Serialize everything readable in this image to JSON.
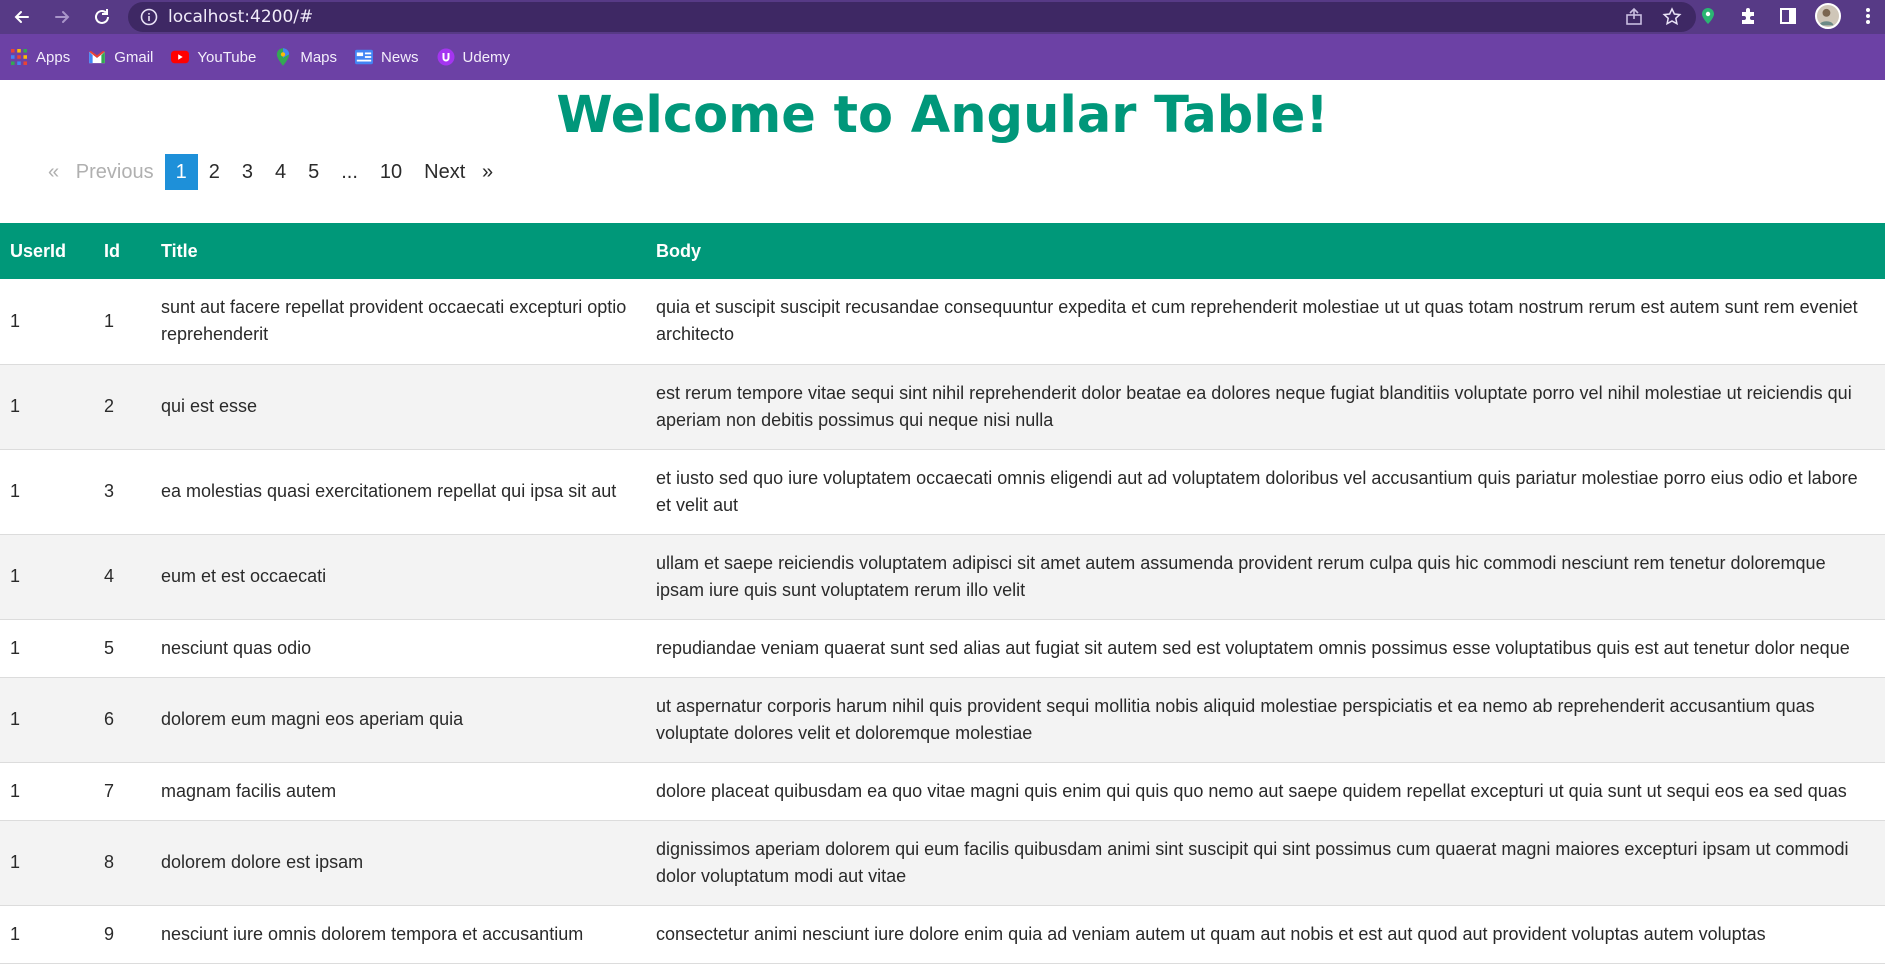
{
  "browser": {
    "url": "localhost:4200/#",
    "bookmarks": [
      {
        "label": "Apps",
        "icon": "apps-grid-icon"
      },
      {
        "label": "Gmail",
        "icon": "gmail-icon"
      },
      {
        "label": "YouTube",
        "icon": "youtube-icon"
      },
      {
        "label": "Maps",
        "icon": "maps-pin-icon"
      },
      {
        "label": "News",
        "icon": "news-icon"
      },
      {
        "label": "Udemy",
        "icon": "udemy-icon"
      }
    ],
    "colors": {
      "toolbar": "#573a86",
      "bookmarks_bar": "#6c41a5",
      "omnibox": "#3e2864"
    }
  },
  "page": {
    "heading": "Welcome to Angular Table!",
    "accent_color": "#00977a"
  },
  "pager": {
    "prev_symbol": "«",
    "prev_label": "Previous",
    "pages": [
      "1",
      "2",
      "3",
      "4",
      "5"
    ],
    "ellipsis": "...",
    "last_page": "10",
    "next_label": "Next",
    "next_symbol": "»",
    "current": "1"
  },
  "table": {
    "headers": [
      "UserId",
      "Id",
      "Title",
      "Body"
    ],
    "rows": [
      {
        "userId": "1",
        "id": "1",
        "title": "sunt aut facere repellat provident occaecati excepturi optio reprehenderit",
        "body": "quia et suscipit suscipit recusandae consequuntur expedita et cum reprehenderit molestiae ut ut quas totam nostrum rerum est autem sunt rem eveniet architecto"
      },
      {
        "userId": "1",
        "id": "2",
        "title": "qui est esse",
        "body": "est rerum tempore vitae sequi sint nihil reprehenderit dolor beatae ea dolores neque fugiat blanditiis voluptate porro vel nihil molestiae ut reiciendis qui aperiam non debitis possimus qui neque nisi nulla"
      },
      {
        "userId": "1",
        "id": "3",
        "title": "ea molestias quasi exercitationem repellat qui ipsa sit aut",
        "body": "et iusto sed quo iure voluptatem occaecati omnis eligendi aut ad voluptatem doloribus vel accusantium quis pariatur molestiae porro eius odio et labore et velit aut"
      },
      {
        "userId": "1",
        "id": "4",
        "title": "eum et est occaecati",
        "body": "ullam et saepe reiciendis voluptatem adipisci sit amet autem assumenda provident rerum culpa quis hic commodi nesciunt rem tenetur doloremque ipsam iure quis sunt voluptatem rerum illo velit"
      },
      {
        "userId": "1",
        "id": "5",
        "title": "nesciunt quas odio",
        "body": "repudiandae veniam quaerat sunt sed alias aut fugiat sit autem sed est voluptatem omnis possimus esse voluptatibus quis est aut tenetur dolor neque"
      },
      {
        "userId": "1",
        "id": "6",
        "title": "dolorem eum magni eos aperiam quia",
        "body": "ut aspernatur corporis harum nihil quis provident sequi mollitia nobis aliquid molestiae perspiciatis et ea nemo ab reprehenderit accusantium quas voluptate dolores velit et doloremque molestiae"
      },
      {
        "userId": "1",
        "id": "7",
        "title": "magnam facilis autem",
        "body": "dolore placeat quibusdam ea quo vitae magni quis enim qui quis quo nemo aut saepe quidem repellat excepturi ut quia sunt ut sequi eos ea sed quas"
      },
      {
        "userId": "1",
        "id": "8",
        "title": "dolorem dolore est ipsam",
        "body": "dignissimos aperiam dolorem qui eum facilis quibusdam animi sint suscipit qui sint possimus cum quaerat magni maiores excepturi ipsam ut commodi dolor voluptatum modi aut vitae"
      },
      {
        "userId": "1",
        "id": "9",
        "title": "nesciunt iure omnis dolorem tempora et accusantium",
        "body": "consectetur animi nesciunt iure dolore enim quia ad veniam autem ut quam aut nobis et est aut quod aut provident voluptas autem voluptas"
      }
    ]
  }
}
